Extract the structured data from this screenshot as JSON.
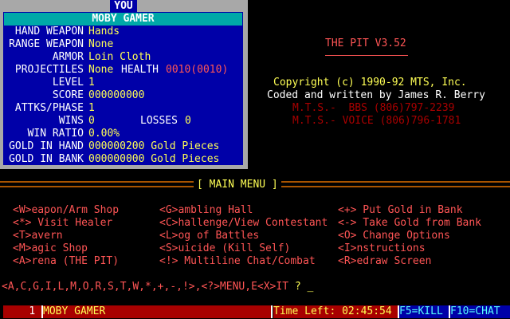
{
  "you_panel": {
    "tab": "YOU",
    "name": "MOBY GAMER",
    "stats": [
      {
        "label": "HAND WEAPON",
        "value": "Hands"
      },
      {
        "label": "RANGE WEAPON",
        "value": "None"
      },
      {
        "label": "ARMOR",
        "value": "Loin Cloth"
      },
      {
        "label": "PROJECTILES",
        "value": "None"
      },
      {
        "label": "LEVEL",
        "value": "1"
      },
      {
        "label": "SCORE",
        "value": "000000000"
      },
      {
        "label": "ATTKS/PHASE",
        "value": "1"
      },
      {
        "label": "WINS",
        "value": "0"
      },
      {
        "label": "WIN RATIO",
        "value": "0.00%"
      },
      {
        "label": "GOLD IN HAND",
        "value": "000000200 Gold Pieces"
      },
      {
        "label": "GOLD IN BANK",
        "value": "000000000 Gold Pieces"
      }
    ],
    "health_label": "HEALTH",
    "health_value": "0010(0010)",
    "losses_label": "LOSSES",
    "losses_value": "0"
  },
  "banner": {
    "title": "THE PIT V3.52",
    "copyright": "Copyright (c) 1990-92 MTS, Inc.",
    "coded": "Coded and written by James R. Berry",
    "bbs": "M.T.S.-  BBS (806)797-2239",
    "voice": "M.T.S.- VOICE (806)796-1781"
  },
  "main_menu": {
    "title": "[ MAIN MENU ]",
    "col1": [
      "<W>eapon/Arm Shop",
      "<*> Visit Healer",
      "<T>avern",
      "<M>agic Shop",
      "<A>rena (THE PIT)"
    ],
    "col2": [
      "<G>ambling Hall",
      "<C>hallenge/View Contestant",
      "<L>og of Battles",
      "<S>uicide (Kill Self)",
      "<!> Multiline Chat/Combat"
    ],
    "col3": [
      "<+> Put Gold in Bank",
      "<-> Take Gold from Bank",
      "<O> Change Options",
      "<I>nstructions",
      "<R>edraw Screen"
    ]
  },
  "prompt": {
    "keys": "<A,C,G,I,L,M,O,R,S,T,W,*,+,-,!>,<?>MENU,E<X>IT",
    "question": " ? ",
    "cursor": "_"
  },
  "status_bar": {
    "node": "1",
    "user": "MOBY GAMER",
    "time_left": "Time Left: 02:45:54",
    "f5": "F5=KILL",
    "f10": "F10=CHAT"
  },
  "colors": {
    "panel_blue": "#0000a8",
    "highlight_cyan": "#00a8a8",
    "text_yellow": "#ffff55",
    "text_red": "#ff5555",
    "dark_red": "#a80000",
    "menu_rule": "#a85400"
  }
}
